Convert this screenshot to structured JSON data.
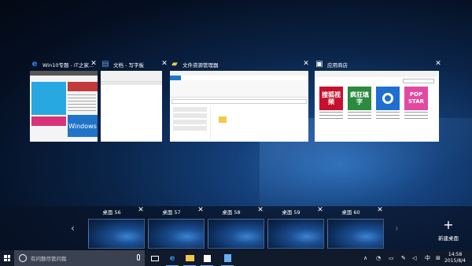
{
  "windows": [
    {
      "title": "Win10专题 - IT之家...",
      "icon": "edge-icon",
      "close": "✕"
    },
    {
      "title": "文档 - 写字板",
      "icon": "wordpad-icon",
      "close": "✕"
    },
    {
      "title": "文件资源管理器",
      "icon": "folder-icon",
      "close": "✕"
    },
    {
      "title": "应用商店",
      "icon": "store-icon",
      "close": "✕"
    }
  ],
  "edge_content": {
    "banner": "Windows"
  },
  "store_apps": [
    {
      "name": "搜狐视频",
      "color": "#c8102e"
    },
    {
      "name": "疯狂填字",
      "color": "#2b8a3e"
    },
    {
      "name": "",
      "color": "#1f6fd1"
    },
    {
      "name": "POP STAR",
      "color": "#e24aa1"
    }
  ],
  "desktops": [
    {
      "label": "桌面 56"
    },
    {
      "label": "桌面 57"
    },
    {
      "label": "桌面 58"
    },
    {
      "label": "桌面 59"
    },
    {
      "label": "桌面 60"
    }
  ],
  "new_desktop": {
    "label": "新建桌面",
    "symbol": "+"
  },
  "nav": {
    "prev": "‹",
    "next": "›"
  },
  "taskbar": {
    "search_placeholder": "有问题尽管问我",
    "ime": "中",
    "time": "14:58",
    "date": "2015/8/4"
  },
  "colors": {
    "accent": "#1979ca",
    "taskbar": "#101a2a"
  }
}
